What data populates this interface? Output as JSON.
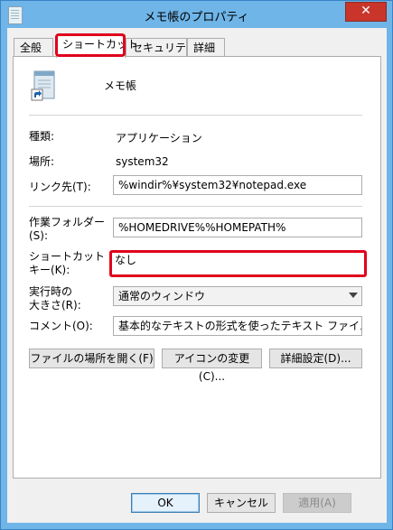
{
  "window": {
    "title": "メモ帳のプロパティ",
    "close_glyph": "✕"
  },
  "tabs": [
    {
      "label": "全般"
    },
    {
      "label": "ショートカット"
    },
    {
      "label": "セキュリティ"
    },
    {
      "label": "詳細"
    }
  ],
  "header": {
    "name": "メモ帳"
  },
  "info": {
    "type_label": "種類:",
    "type_value": "アプリケーション",
    "location_label": "場所:",
    "location_value": "system32",
    "target_label": "リンク先(T):",
    "target_value": "%windir%¥system32¥notepad.exe"
  },
  "form": {
    "workdir_label1": "作業フォルダー",
    "workdir_label2": "(S):",
    "workdir_value": "%HOMEDRIVE%%HOMEPATH%",
    "shortcut_label1": "ショートカット",
    "shortcut_label2": "キー(K):",
    "shortcut_value": "なし",
    "run_label1": "実行時の",
    "run_label2": "大きさ(R):",
    "run_value": "通常のウィンドウ",
    "comment_label": "コメント(O):",
    "comment_value": "基本的なテキストの形式を使ったテキスト ファイルの表示と編集を行います。"
  },
  "buttons": {
    "open_location": "ファイルの場所を開く(F)",
    "change_icon": "アイコンの変更(C)...",
    "advanced": "詳細設定(D)...",
    "ok": "OK",
    "cancel": "キャンセル",
    "apply": "適用(A)"
  },
  "colors": {
    "titlebar": "#6fb5e8",
    "close": "#c9352b",
    "highlight": "#e0001b"
  }
}
